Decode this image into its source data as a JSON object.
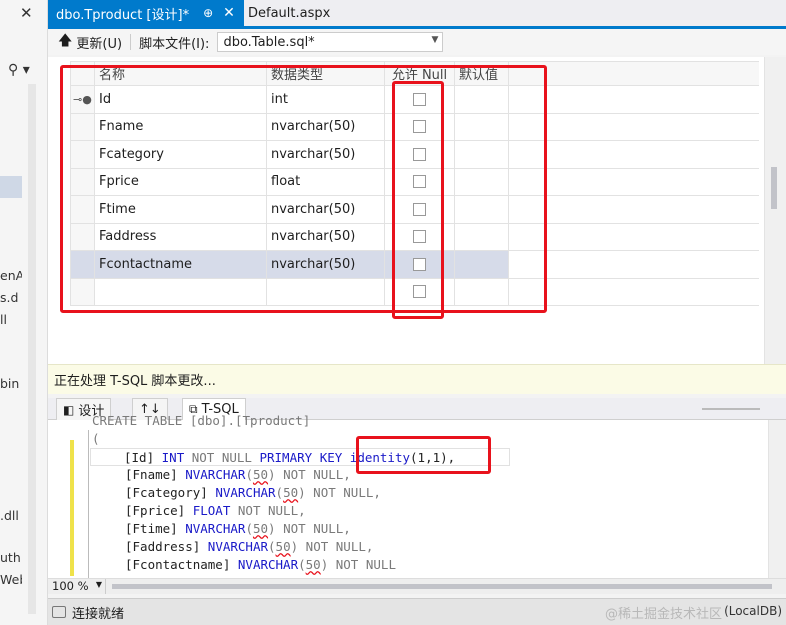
{
  "tabs": [
    {
      "label": "dbo.Tproduct [设计]*",
      "active": true
    },
    {
      "label": "Default.aspx",
      "active": false
    }
  ],
  "toolbar": {
    "update_label": "更新(U)",
    "script_file_label": "脚本文件(I):",
    "script_file_value": "dbo.Table.sql*"
  },
  "grid": {
    "headers": {
      "name": "名称",
      "type": "数据类型",
      "allow_null": "允许 Null",
      "default": "默认值"
    },
    "rows": [
      {
        "name": "Id",
        "type": "int",
        "primary_key": true
      },
      {
        "name": "Fname",
        "type": "nvarchar(50)"
      },
      {
        "name": "Fcategory",
        "type": "nvarchar(50)"
      },
      {
        "name": "Fprice",
        "type": "float"
      },
      {
        "name": "Ftime",
        "type": "nvarchar(50)"
      },
      {
        "name": "Faddress",
        "type": "nvarchar(50)"
      },
      {
        "name": "Fcontactname",
        "type": "nvarchar(50)",
        "selected": true
      },
      {
        "name": "",
        "type": ""
      }
    ]
  },
  "status_strip": "正在处理 T-SQL 脚本更改...",
  "bottom_tabs": {
    "design": "设计",
    "swap": "↑↓",
    "tsql": "T-SQL"
  },
  "editor": {
    "line0": "CREATE TABLE [dbo].[Tproduct]",
    "line1": "(",
    "line2_pre": "[Id] ",
    "line2_int": "INT",
    "line2_notnull": " NOT NULL ",
    "line2_pk": "PRIMARY KEY",
    "line2_identity": " identity",
    "line2_args": "(1,1)",
    "line2_end": ",",
    "lines": [
      {
        "name": "[Fname] ",
        "type": "NVARCHAR",
        "arg": "50",
        "rest": " NOT NULL,"
      },
      {
        "name": "[Fcategory] ",
        "type": "NVARCHAR",
        "arg": "50",
        "rest": " NOT NULL,"
      },
      {
        "name": "[Fprice] ",
        "type": "FLOAT",
        "arg": "",
        "rest": " NOT NULL,"
      },
      {
        "name": "[Ftime] ",
        "type": "NVARCHAR",
        "arg": "50",
        "rest": " NOT NULL,"
      },
      {
        "name": "[Faddress] ",
        "type": "NVARCHAR",
        "arg": "50",
        "rest": " NOT NULL,"
      },
      {
        "name": "[Fcontactname] ",
        "type": "NVARCHAR",
        "arg": "50",
        "rest": " NOT NULL"
      }
    ]
  },
  "zoom": "100 %",
  "status_bar": {
    "ready": "连接就绪",
    "db": "(LocalDB)",
    "watermark": "@稀土掘金技术社区"
  },
  "left_fragments": [
    "enA",
    "s.d",
    "ll",
    "bin",
    ".dll",
    "uth",
    "Web"
  ],
  "colors": {
    "accent": "#007acc",
    "annotation": "#e8121c",
    "keyword": "#1a1ac8"
  }
}
